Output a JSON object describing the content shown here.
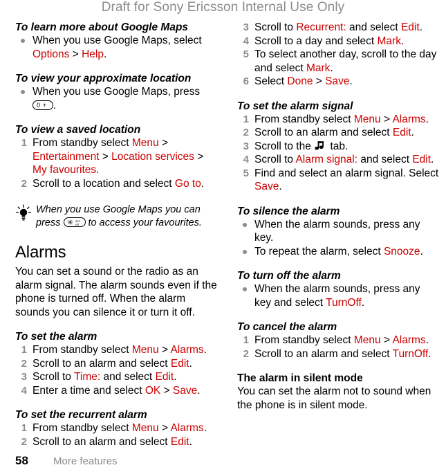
{
  "header": {
    "draft_notice": "Draft for Sony Ericsson Internal Use Only"
  },
  "colors": {
    "ui_string": "#cc0000",
    "marker_gray": "#8c8c8c",
    "header_gray": "#8c8c8c",
    "body_text": "#000000"
  },
  "footer": {
    "page_number": "58",
    "section_name": "More features"
  },
  "left_column": {
    "s1": {
      "heading": "To learn more about Google Maps",
      "b1_a": "When you use Google Maps, select ",
      "b1_ui1": "Options",
      "b1_sep": " > ",
      "b1_ui2": "Help",
      "b1_end": "."
    },
    "s2": {
      "heading": "To view your approximate location",
      "b1_a": "When you use Google Maps, press ",
      "b1_key": "0 +",
      "b1_end": "."
    },
    "s3": {
      "heading": "To view a saved location",
      "n1": "1",
      "n1_a": "From standby select ",
      "n1_ui1": "Menu",
      "n1_sep1": " > ",
      "n1_ui2": "Entertainment",
      "n1_sep2": " > ",
      "n1_ui3": "Location services",
      "n1_sep3": " > ",
      "n1_ui4": "My favourites",
      "n1_end": ".",
      "n2": "2",
      "n2_a": "Scroll to a location and select ",
      "n2_ui1": "Go to",
      "n2_end": "."
    },
    "tip": {
      "text_a": "When you use Google Maps you can press ",
      "key": "star-key",
      "text_b": " to access your favourites."
    },
    "s4": {
      "heading": "Alarms",
      "intro": "You can set a sound or the radio as an alarm signal. The alarm sounds even if the phone is turned off. When the alarm sounds you can silence it or turn it off."
    },
    "s5": {
      "heading": "To set the alarm",
      "n1": "1",
      "n1_a": "From standby select ",
      "n1_ui1": "Menu",
      "n1_sep1": " > ",
      "n1_ui2": "Alarms",
      "n1_end": ".",
      "n2": "2",
      "n2_a": "Scroll to an alarm and select ",
      "n2_ui1": "Edit",
      "n2_end": ".",
      "n3": "3",
      "n3_a": "Scroll to ",
      "n3_ui1": "Time:",
      "n3_b": " and select ",
      "n3_ui2": "Edit",
      "n3_end": ".",
      "n4": "4",
      "n4_a": "Enter a time and select ",
      "n4_ui1": "OK",
      "n4_sep1": " > ",
      "n4_ui2": "Save",
      "n4_end": "."
    },
    "s6": {
      "heading": "To set the recurrent alarm",
      "n1": "1",
      "n1_a": "From standby select ",
      "n1_ui1": "Menu",
      "n1_sep1": " > ",
      "n1_ui2": "Alarms",
      "n1_end": ".",
      "n2": "2",
      "n2_a": "Scroll to an alarm and select ",
      "n2_ui1": "Edit",
      "n2_end": "."
    }
  },
  "right_column": {
    "s6cont": {
      "n3": "3",
      "n3_a": "Scroll to ",
      "n3_ui1": "Recurrent:",
      "n3_b": " and select ",
      "n3_ui2": "Edit",
      "n3_end": ".",
      "n4": "4",
      "n4_a": "Scroll to a day and select ",
      "n4_ui1": "Mark",
      "n4_end": ".",
      "n5": "5",
      "n5_a": "To select another day, scroll to the day and select ",
      "n5_ui1": "Mark",
      "n5_end": ".",
      "n6": "6",
      "n6_a": "Select ",
      "n6_ui1": "Done",
      "n6_sep1": " > ",
      "n6_ui2": "Save",
      "n6_end": "."
    },
    "s7": {
      "heading": "To set the alarm signal",
      "n1": "1",
      "n1_a": "From standby select ",
      "n1_ui1": "Menu",
      "n1_sep1": " > ",
      "n1_ui2": "Alarms",
      "n1_end": ".",
      "n2": "2",
      "n2_a": "Scroll to an alarm and select ",
      "n2_ui1": "Edit",
      "n2_end": ".",
      "n3": "3",
      "n3_a": "Scroll to the ",
      "n3_icon": "music-note-icon",
      "n3_b": " tab.",
      "n4": "4",
      "n4_a": "Scroll to ",
      "n4_ui1": "Alarm signal:",
      "n4_b": " and select ",
      "n4_ui2": "Edit",
      "n4_end": ".",
      "n5": "5",
      "n5_a": "Find and select an alarm signal. Select ",
      "n5_ui1": "Save",
      "n5_end": "."
    },
    "s8": {
      "heading": "To silence the alarm",
      "b1": "When the alarm sounds, press any key.",
      "b2_a": "To repeat the alarm, select ",
      "b2_ui1": "Snooze",
      "b2_end": "."
    },
    "s9": {
      "heading": "To turn off the alarm",
      "b1_a": "When the alarm sounds, press any key and select ",
      "b1_ui1": "TurnOff",
      "b1_end": "."
    },
    "s10": {
      "heading": "To cancel the alarm",
      "n1": "1",
      "n1_a": "From standby select ",
      "n1_ui1": "Menu",
      "n1_sep1": " > ",
      "n1_ui2": "Alarms",
      "n1_end": ".",
      "n2": "2",
      "n2_a": "Scroll to an alarm and select ",
      "n2_ui1": "TurnOff",
      "n2_end": "."
    },
    "s11": {
      "heading": "The alarm in silent mode",
      "body": "You can set the alarm not to sound when the phone is in silent mode."
    }
  }
}
